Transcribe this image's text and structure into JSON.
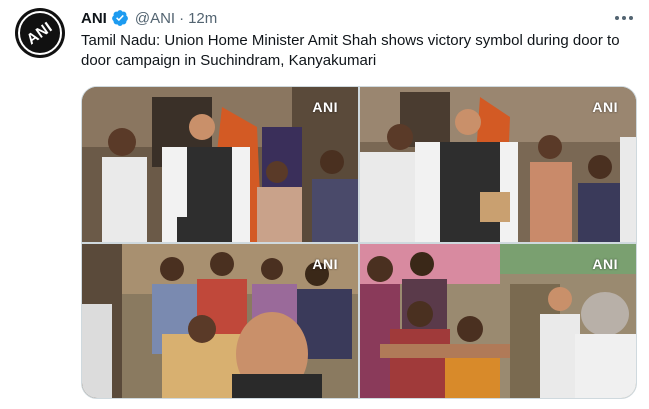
{
  "tweet": {
    "author_name": "ANI",
    "handle": "@ANI",
    "separator": "·",
    "time": "12m",
    "text": "Tamil Nadu: Union Home Minister Amit Shah shows victory symbol during door to door campaign in Suchindram, Kanyakumari",
    "avatar_text": "ANI"
  },
  "media": {
    "watermarks": [
      "ANI",
      "ANI",
      "ANI",
      "ANI"
    ]
  },
  "colors": {
    "verified": "#1d9bf0",
    "secondary_text": "#536471",
    "border": "#cfd9de"
  },
  "icons": {
    "verified": "verified-badge-icon",
    "more": "more-options-icon"
  }
}
